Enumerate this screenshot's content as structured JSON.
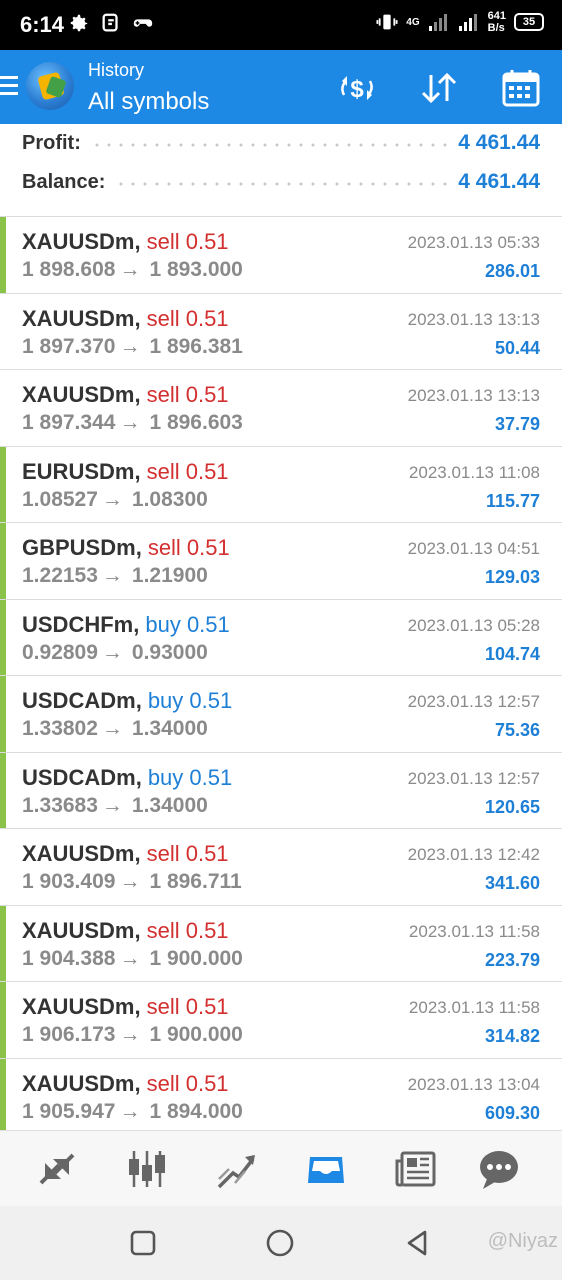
{
  "status_bar": {
    "time": "6:14",
    "network": "4G",
    "speed": [
      "641",
      "B/s"
    ],
    "battery": "35"
  },
  "app_bar": {
    "subtitle": "History",
    "title": "All symbols"
  },
  "summary": {
    "profit_label": "Profit:",
    "profit_value": "4 461.44",
    "balance_label": "Balance:",
    "balance_value": "4 461.44"
  },
  "deals": [
    {
      "symbol": "XAUUSDm",
      "type": "sell",
      "volume": "sell 0.51",
      "open": "1 898.608",
      "close": "1 893.000",
      "time": "2023.01.13 05:33",
      "profit": "286.01",
      "marked": true
    },
    {
      "symbol": "XAUUSDm",
      "type": "sell",
      "volume": "sell 0.51",
      "open": "1 897.370",
      "close": "1 896.381",
      "time": "2023.01.13 13:13",
      "profit": "50.44",
      "marked": false
    },
    {
      "symbol": "XAUUSDm",
      "type": "sell",
      "volume": "sell 0.51",
      "open": "1 897.344",
      "close": "1 896.603",
      "time": "2023.01.13 13:13",
      "profit": "37.79",
      "marked": false
    },
    {
      "symbol": "EURUSDm",
      "type": "sell",
      "volume": "sell 0.51",
      "open": "1.08527",
      "close": "1.08300",
      "time": "2023.01.13 11:08",
      "profit": "115.77",
      "marked": true
    },
    {
      "symbol": "GBPUSDm",
      "type": "sell",
      "volume": "sell 0.51",
      "open": "1.22153",
      "close": "1.21900",
      "time": "2023.01.13 04:51",
      "profit": "129.03",
      "marked": true
    },
    {
      "symbol": "USDCHFm",
      "type": "buy",
      "volume": "buy 0.51",
      "open": "0.92809",
      "close": "0.93000",
      "time": "2023.01.13 05:28",
      "profit": "104.74",
      "marked": true
    },
    {
      "symbol": "USDCADm",
      "type": "buy",
      "volume": "buy 0.51",
      "open": "1.33802",
      "close": "1.34000",
      "time": "2023.01.13 12:57",
      "profit": "75.36",
      "marked": true
    },
    {
      "symbol": "USDCADm",
      "type": "buy",
      "volume": "buy 0.51",
      "open": "1.33683",
      "close": "1.34000",
      "time": "2023.01.13 12:57",
      "profit": "120.65",
      "marked": true
    },
    {
      "symbol": "XAUUSDm",
      "type": "sell",
      "volume": "sell 0.51",
      "open": "1 903.409",
      "close": "1 896.711",
      "time": "2023.01.13 12:42",
      "profit": "341.60",
      "marked": false
    },
    {
      "symbol": "XAUUSDm",
      "type": "sell",
      "volume": "sell 0.51",
      "open": "1 904.388",
      "close": "1 900.000",
      "time": "2023.01.13 11:58",
      "profit": "223.79",
      "marked": true
    },
    {
      "symbol": "XAUUSDm",
      "type": "sell",
      "volume": "sell 0.51",
      "open": "1 906.173",
      "close": "1 900.000",
      "time": "2023.01.13 11:58",
      "profit": "314.82",
      "marked": true
    },
    {
      "symbol": "XAUUSDm",
      "type": "sell",
      "volume": "sell 0.51",
      "open": "1 905.947",
      "close": "1 894.000",
      "time": "2023.01.13 13:04",
      "profit": "609.30",
      "marked": true
    }
  ],
  "arrow_glyph": "→",
  "bottom_nav": [
    {
      "icon": "quotes-icon"
    },
    {
      "icon": "chart-icon"
    },
    {
      "icon": "trade-icon"
    },
    {
      "icon": "history-icon",
      "active": true
    },
    {
      "icon": "news-icon"
    },
    {
      "icon": "chat-icon"
    }
  ],
  "watermark": "@Niyaz",
  "colors": {
    "accent": "#1e88e5",
    "sell": "#d32f2f",
    "buy": "#1e7fd6",
    "marker": "#8bc34a"
  }
}
